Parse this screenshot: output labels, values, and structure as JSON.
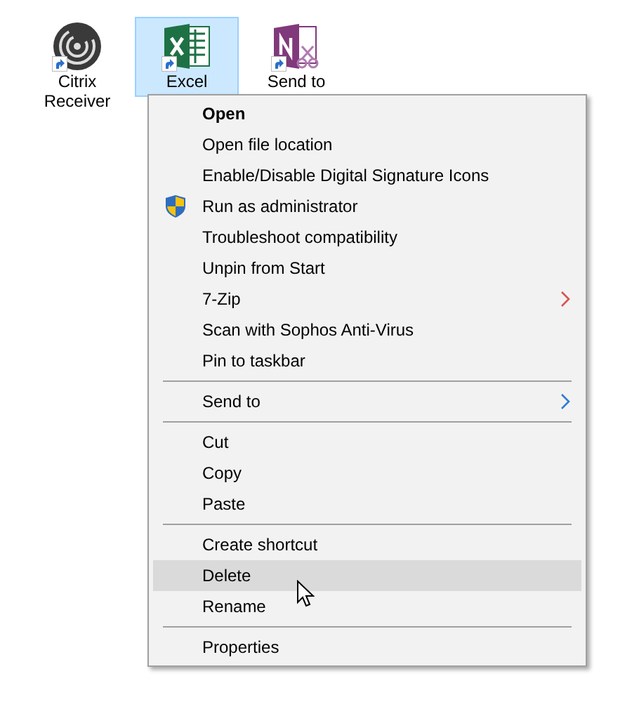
{
  "desktop_icons": [
    {
      "label": "Citrix Receiver",
      "kind": "citrix",
      "selected": false
    },
    {
      "label": "Excel",
      "kind": "excel",
      "selected": true
    },
    {
      "label": "Send to",
      "kind": "onenote",
      "selected": false
    }
  ],
  "context_menu": {
    "groups": [
      [
        {
          "label": "Open",
          "kind": "default",
          "selected": false
        },
        {
          "label": "Open file location",
          "kind": "item",
          "selected": false
        },
        {
          "label": "Enable/Disable Digital Signature Icons",
          "kind": "item",
          "selected": false
        },
        {
          "label": "Run as administrator",
          "kind": "admin",
          "selected": false
        },
        {
          "label": "Troubleshoot compatibility",
          "kind": "item",
          "selected": false
        },
        {
          "label": "Unpin from Start",
          "kind": "item",
          "selected": false
        },
        {
          "label": "7-Zip",
          "kind": "submenu",
          "color": "#d9534f",
          "selected": false
        },
        {
          "label": "Scan with Sophos Anti-Virus",
          "kind": "item",
          "selected": false
        },
        {
          "label": "Pin to taskbar",
          "kind": "item",
          "selected": false
        }
      ],
      [
        {
          "label": "Send to",
          "kind": "submenu",
          "color": "#2e7dd1",
          "selected": false
        }
      ],
      [
        {
          "label": "Cut",
          "kind": "item",
          "selected": false
        },
        {
          "label": "Copy",
          "kind": "item",
          "selected": false
        },
        {
          "label": "Paste",
          "kind": "item",
          "selected": false
        }
      ],
      [
        {
          "label": "Create shortcut",
          "kind": "item",
          "selected": false
        },
        {
          "label": "Delete",
          "kind": "item",
          "selected": true
        },
        {
          "label": "Rename",
          "kind": "item",
          "selected": false
        }
      ],
      [
        {
          "label": "Properties",
          "kind": "item",
          "selected": false
        }
      ]
    ]
  }
}
